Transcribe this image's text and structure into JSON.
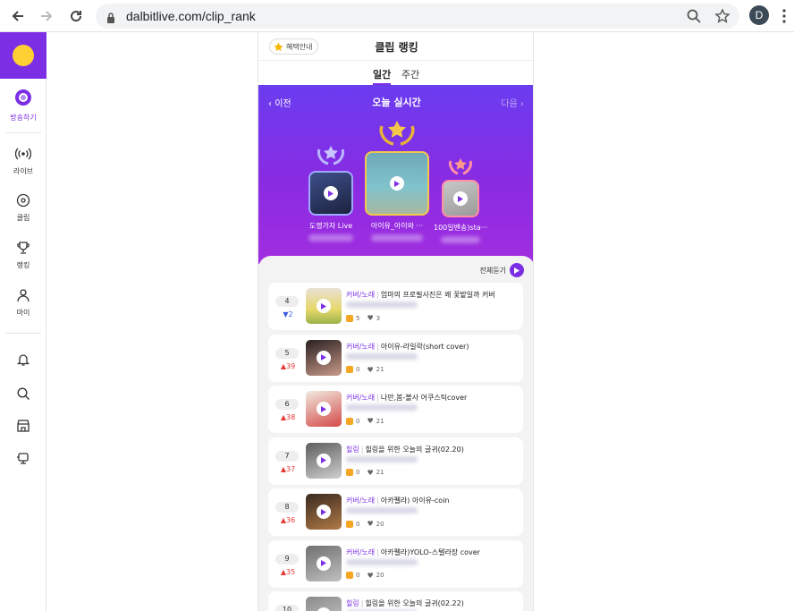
{
  "browser": {
    "url": "dalbitlive.com/clip_rank",
    "profile_initial": "D"
  },
  "sidebar": {
    "items": [
      {
        "label": "방송하기",
        "icon": "broadcast-ring-icon",
        "active": true
      },
      {
        "label": "라이브",
        "icon": "live-signal-icon"
      },
      {
        "label": "클립",
        "icon": "clip-disc-icon"
      },
      {
        "label": "랭킹",
        "icon": "trophy-icon"
      },
      {
        "label": "마이",
        "icon": "person-icon"
      }
    ],
    "utility_icons": [
      "bell-icon",
      "search-icon",
      "store-icon",
      "message-icon"
    ]
  },
  "header": {
    "benefit_label": "혜택안내",
    "title": "클립 랭킹"
  },
  "tabs": [
    {
      "label": "일간",
      "active": true
    },
    {
      "label": "주간",
      "active": false
    }
  ],
  "hero": {
    "prev_label": "이전",
    "title": "오늘 실시간",
    "next_label": "다음",
    "top3": [
      {
        "rank": 2,
        "name": "도명가자 Live"
      },
      {
        "rank": 1,
        "name": "아이유_아이와 ···"
      },
      {
        "rank": 3,
        "name": "100일밴송)sta···"
      }
    ]
  },
  "list": {
    "listen_all_label": "전체듣기",
    "items": [
      {
        "rank": "4",
        "delta": "2",
        "dir": "down",
        "category": "커버/노래",
        "title": "엄마의 프로필사진은 왜 꽃밭일까 커버",
        "gifts": "5",
        "likes": "3"
      },
      {
        "rank": "5",
        "delta": "39",
        "dir": "up",
        "category": "커버/노래",
        "title": "아이유-라일락(short cover)",
        "gifts": "0",
        "likes": "21"
      },
      {
        "rank": "6",
        "delta": "38",
        "dir": "up",
        "category": "커버/노래",
        "title": "나만,봄-볼사 어쿠스틱cover",
        "gifts": "0",
        "likes": "21"
      },
      {
        "rank": "7",
        "delta": "37",
        "dir": "up",
        "category": "힐링",
        "title": "힐링을 위한 오늘의 글귀(02.20)",
        "gifts": "0",
        "likes": "21"
      },
      {
        "rank": "8",
        "delta": "36",
        "dir": "up",
        "category": "커버/노래",
        "title": "아카펠라) 아이유-coin",
        "gifts": "0",
        "likes": "20"
      },
      {
        "rank": "9",
        "delta": "35",
        "dir": "up",
        "category": "커버/노래",
        "title": "아카펠라)YOLO-스텔라장 cover",
        "gifts": "0",
        "likes": "20"
      },
      {
        "rank": "10",
        "delta": "",
        "dir": "up",
        "category": "힐링",
        "title": "힐링을 위한 오늘의 글귀(02.22)",
        "gifts": "",
        "likes": ""
      }
    ]
  },
  "colors": {
    "accent": "#7c2ee5",
    "hero_top": "#6a3cf0",
    "hero_bottom": "#a12ee0",
    "up": "#e53935",
    "down": "#3a5be0"
  }
}
